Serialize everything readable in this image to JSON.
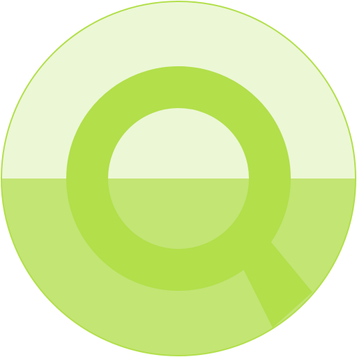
{
  "icon": {
    "name": "search-icon",
    "colors": {
      "background": "#ffffff",
      "circle_top": "#ecf7d6",
      "circle_bottom": "#c3e574",
      "circle_border": "#b2df4a",
      "magnifier": "#b2df4a"
    }
  }
}
